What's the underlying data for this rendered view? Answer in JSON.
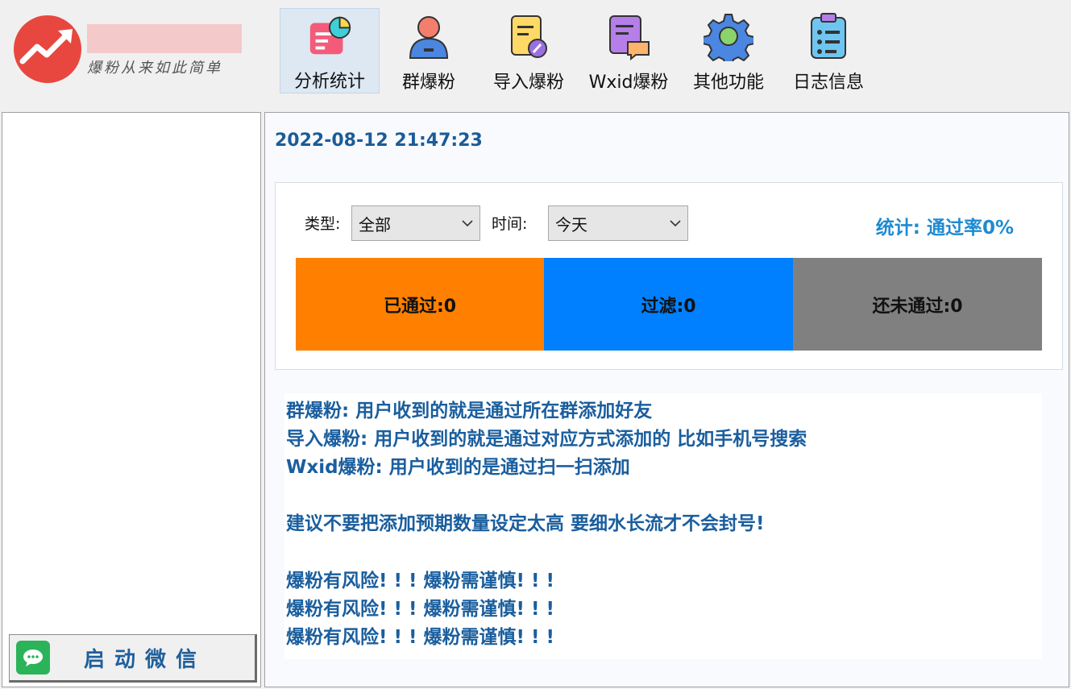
{
  "header": {
    "slogan": "爆粉从来如此简单",
    "toolbar": [
      {
        "label": "分析统计",
        "icon": "chart-card-icon",
        "active": true
      },
      {
        "label": "群爆粉",
        "icon": "user-icon",
        "active": false
      },
      {
        "label": "导入爆粉",
        "icon": "import-doc-icon",
        "active": false
      },
      {
        "label": "Wxid爆粉",
        "icon": "chat-doc-icon",
        "active": false
      },
      {
        "label": "其他功能",
        "icon": "gear-icon",
        "active": false
      },
      {
        "label": "日志信息",
        "icon": "clipboard-list-icon",
        "active": false
      }
    ]
  },
  "left_panel": {
    "start_button_label": "启动微信"
  },
  "main": {
    "datetime": "2022-08-12 21:47:23",
    "filters": {
      "type_label": "类型:",
      "type_value": "全部",
      "time_label": "时间:",
      "time_value": "今天"
    },
    "stat_summary": "统计: 通过率0%",
    "stats": [
      {
        "label": "已通过:0",
        "color": "#ff8000"
      },
      {
        "label": "过滤:0",
        "color": "#0080ff"
      },
      {
        "label": "还未通过:0",
        "color": "#808080"
      }
    ],
    "notes": [
      "群爆粉: 用户收到的就是通过所在群添加好友",
      "导入爆粉: 用户收到的就是通过对应方式添加的 比如手机号搜索",
      "Wxid爆粉: 用户收到的是通过扫一扫添加",
      "",
      "建议不要把添加预期数量设定太高 要细水长流才不会封号!",
      "",
      "爆粉有风险! ! ! 爆粉需谨慎! ! !",
      "爆粉有风险! ! ! 爆粉需谨慎! ! !",
      "爆粉有风险! ! ! 爆粉需谨慎! ! !"
    ]
  },
  "colors": {
    "accent_blue": "#1b5c98",
    "logo_red": "#e8473f"
  }
}
